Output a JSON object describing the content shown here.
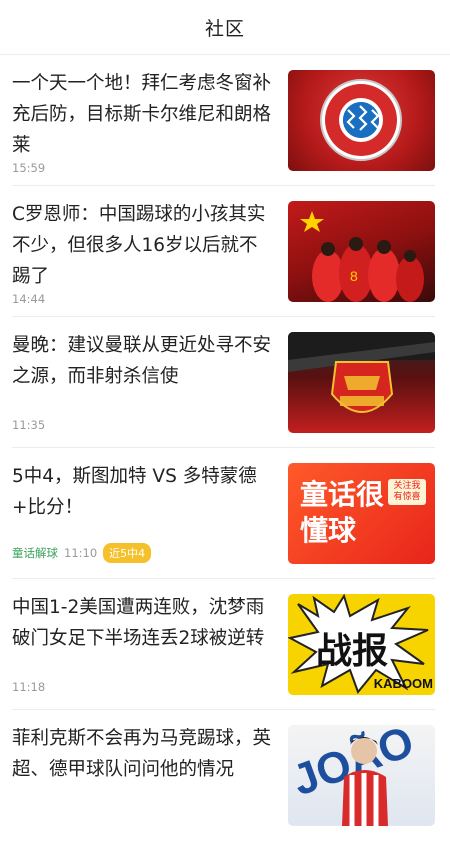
{
  "header": {
    "title": "社区"
  },
  "feed": [
    {
      "headline": "一个天一个地！拜仁考虑冬窗补充后防，目标斯卡尔维尼和朗格莱",
      "time": "15:59"
    },
    {
      "headline": "C罗恩师：中国踢球的小孩其实不少，但很多人16岁以后就不踢了",
      "time": "14:44"
    },
    {
      "headline": "曼晚：建议曼联从更近处寻不安之源，而非射杀信使",
      "time": "11:35"
    },
    {
      "headline": "5中4，斯图加特 VS 多特蒙德+比分！",
      "source": "童话解球",
      "time": "11:10",
      "badge": "近5中4",
      "thumb_text_main": "童话很懂球",
      "thumb_text_tag": "关注我 有惊喜"
    },
    {
      "headline": "中国1-2美国遭两连败，沈梦雨破门女足下半场连丢2球被逆转",
      "time": "11:18",
      "thumb_text_main": "战报",
      "thumb_text_sub": "KABOOM"
    },
    {
      "headline": "菲利克斯不会再为马竞踢球，英超、德甲球队问问他的情况",
      "time": ""
    }
  ],
  "thumbs": {
    "t1_icon": "fc-bayern-logo",
    "t2_icon": "china-team-huddle",
    "t3_icon": "man-united-crest",
    "t6_icon": "atletico-player"
  }
}
